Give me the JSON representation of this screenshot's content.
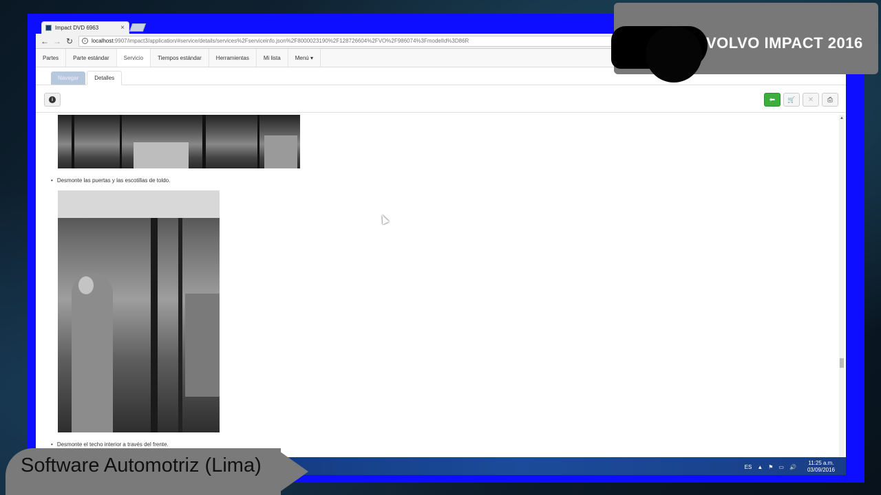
{
  "browser": {
    "tab_title": "Impact DVD 6963",
    "tab_close": "×",
    "url_host": "localhost",
    "url_rest": ":9907/impact3/application/#service/details/services%2Fserviceinfo.json%2F8000023190%2F128726604%2FVO%2F986074%3FmodelId%3D86R"
  },
  "menu": {
    "items": [
      "Partes",
      "Parte estándar",
      "Servicio",
      "Tiempos estándar",
      "Herramientas",
      "Mi lista",
      "Menú ▾"
    ],
    "active_index": 2
  },
  "subtabs": {
    "navigate": "Navegar",
    "details": "Detalles"
  },
  "toolbar": {
    "info_icon": "i",
    "back_icon": "🡐",
    "cart_icon": "🛒",
    "tools_icon": "✕",
    "print_icon": "⎙"
  },
  "content": {
    "step_1": "Desmonte las puertas y las escotillas de toldo.",
    "step_2": "Desmonte el techo interior a través del frente."
  },
  "taskbar": {
    "lang": "ES",
    "time": "11:25 a.m.",
    "date": "03/09/2016"
  },
  "overlay": {
    "brand": "VOLVO IMPACT 2016",
    "footer": "Software Automotriz (Lima)"
  }
}
